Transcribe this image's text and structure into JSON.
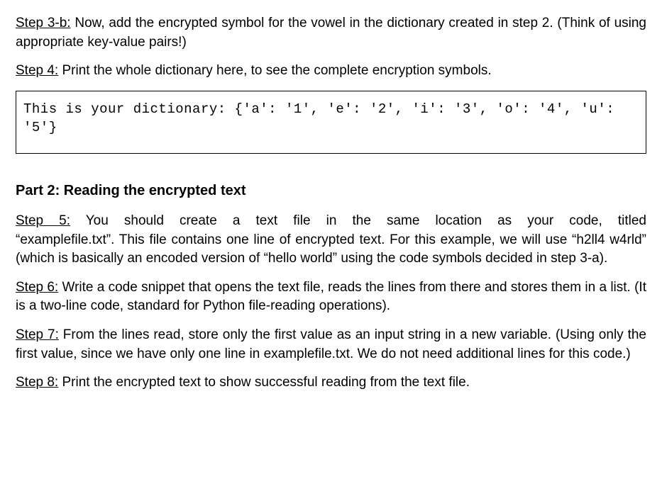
{
  "step3b": {
    "label": "Step 3-b:",
    "text": " Now, add the encrypted symbol for the vowel in the dictionary created in step 2. (Think of using appropriate key-value pairs!)"
  },
  "step4": {
    "label": "Step 4:",
    "text": " Print the whole dictionary here, to see the complete encryption symbols."
  },
  "code_output": "This is your dictionary: {'a': '1', 'e': '2', 'i': '3', 'o': '4', 'u': '5'}",
  "part2_heading": "Part 2: Reading the encrypted text",
  "step5": {
    "label": "Step 5:",
    "line1": " You should create a text file in the same location as your code, titled",
    "rest": "“examplefile.txt”. This file contains one line of encrypted text. For this example, we will use “h2ll4 w4rld” (which is basically an encoded version of “hello world” using the code symbols decided in step 3-a)."
  },
  "step6": {
    "label": "Step 6:",
    "text": " Write a code snippet that opens the text file, reads the lines from there and stores them in a list. (It is a two-line code, standard for Python file-reading operations)."
  },
  "step7": {
    "label": "Step 7:",
    "text": " From the lines read, store only the first value as an input string in a new variable. (Using only the first value, since we have only one line in examplefile.txt. We do not need additional lines for this code.)"
  },
  "step8": {
    "label": "Step 8:",
    "text": " Print the encrypted text to show successful reading from the text file."
  }
}
